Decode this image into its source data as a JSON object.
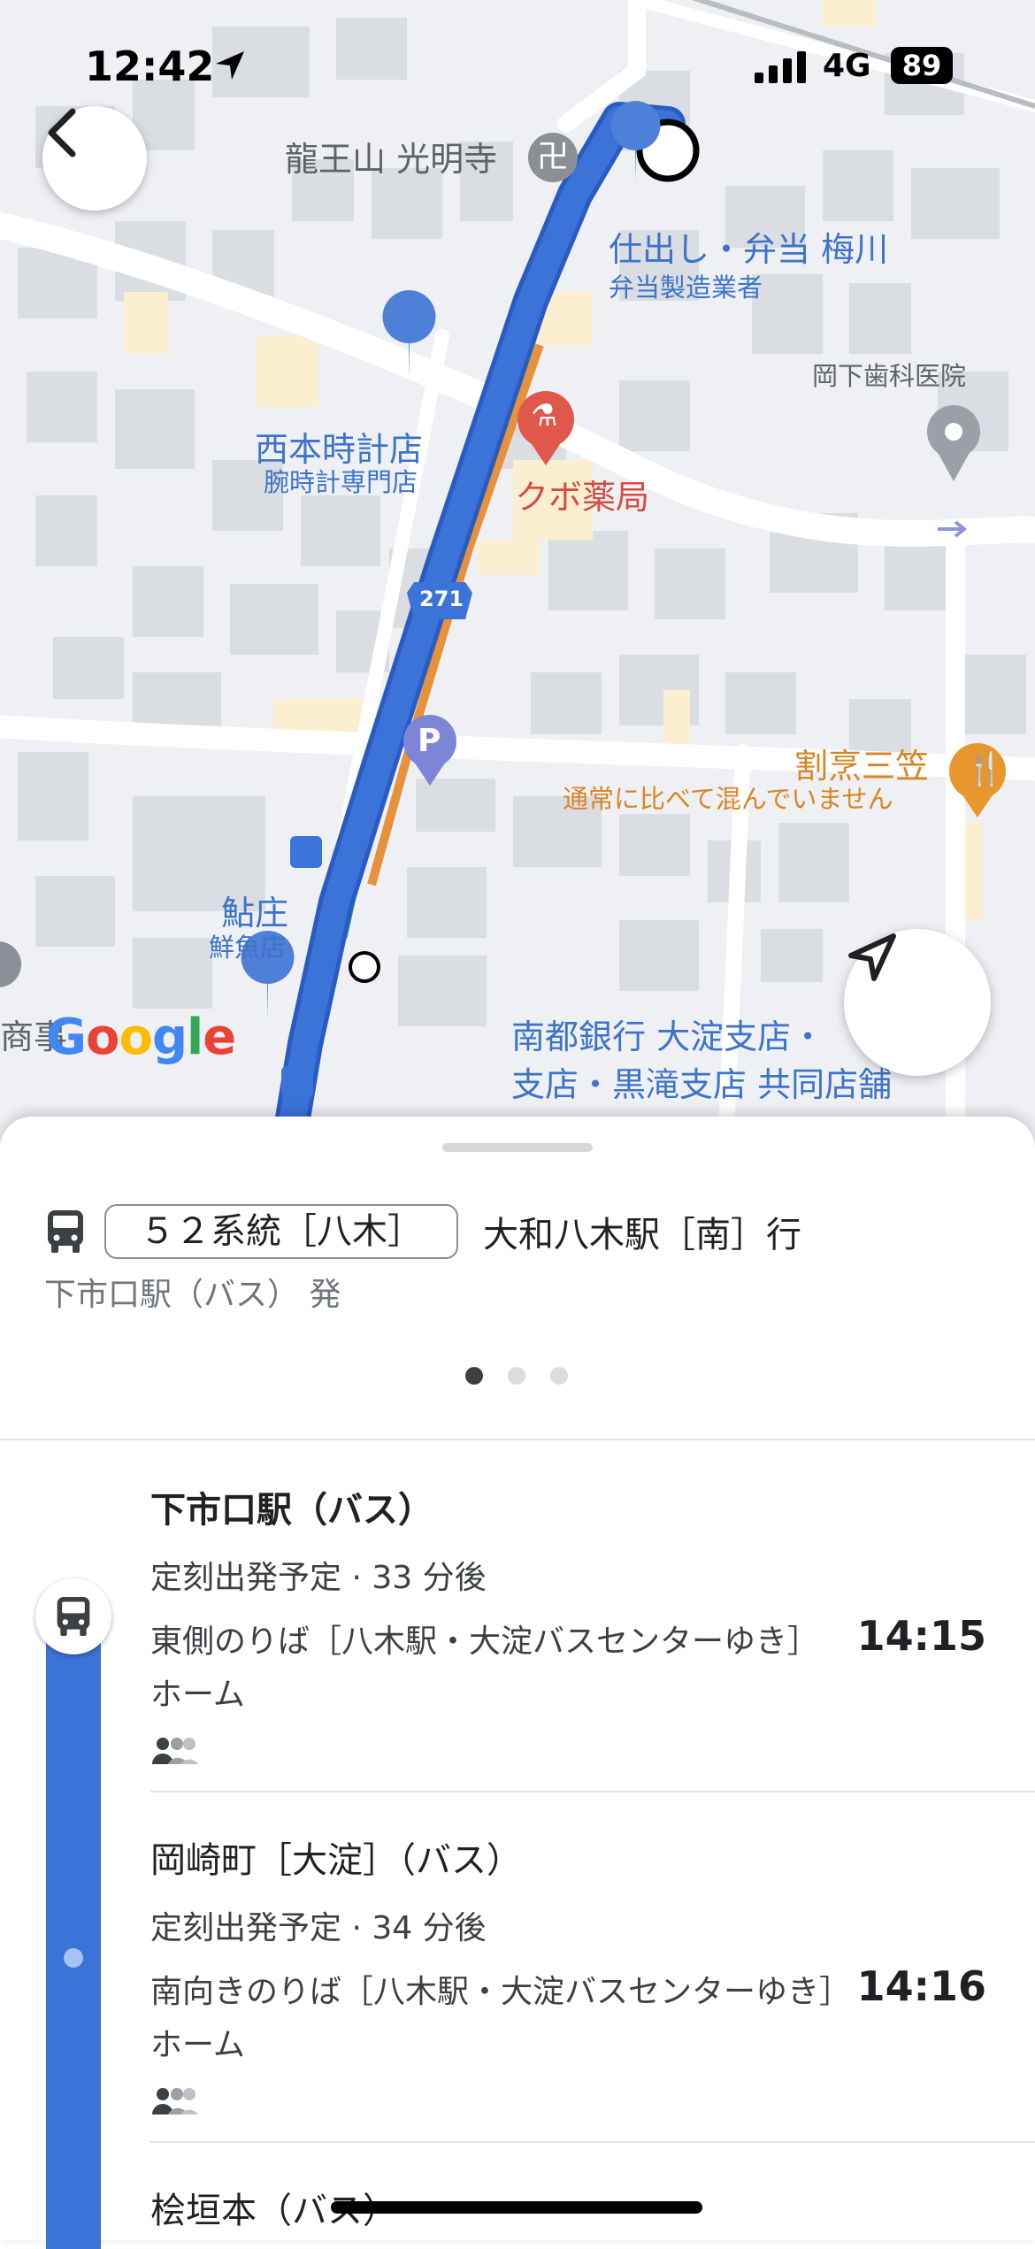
{
  "status_bar": {
    "time": "12:42",
    "network": "4G",
    "battery": "89"
  },
  "map": {
    "labels": {
      "temple": "龍王山 光明寺",
      "bento_name": "仕出し・弁当 梅川",
      "bento_type": "弁当製造業者",
      "dentist": "岡下歯科医院",
      "watch_store": "西本時計店",
      "watch_store_type": "腕時計専門店",
      "pharmacy": "クボ薬局",
      "route_shield": "271",
      "parking": "P",
      "restaurant": "割烹三笠",
      "restaurant_busy": "通常に比べて混んでいません",
      "fish_store": "鮎庄",
      "fish_store_type": "鮮魚店",
      "bank_line1": "南都銀行 大淀支店・",
      "bank_line2": "支店・黒滝支店 共同店舗",
      "partial_left": "商事",
      "google": [
        "G",
        "o",
        "o",
        "g",
        "l",
        "e"
      ]
    },
    "colors": {
      "route": "#3b73d9",
      "accent_orange": "#e7913a"
    }
  },
  "route": {
    "line": "５２系統［八木］",
    "destination": "大和八木駅［南］行",
    "departure_from": "下市口駅（バス） 発",
    "page_count": 3,
    "active_page": 1
  },
  "stops": [
    {
      "name": "下市口駅（バス）",
      "schedule": "定刻出発予定 · 33 分後",
      "platform": "東側のりば［八木駅・大淀バスセンターゆき］ホーム",
      "time": "14:15"
    },
    {
      "name": "岡崎町［大淀］（バス）",
      "schedule": "定刻出発予定 · 34 分後",
      "platform": "南向きのりば［八木駅・大淀バスセンターゆき］ホーム",
      "time": "14:16"
    },
    {
      "name": "桧垣本（バス）"
    }
  ]
}
